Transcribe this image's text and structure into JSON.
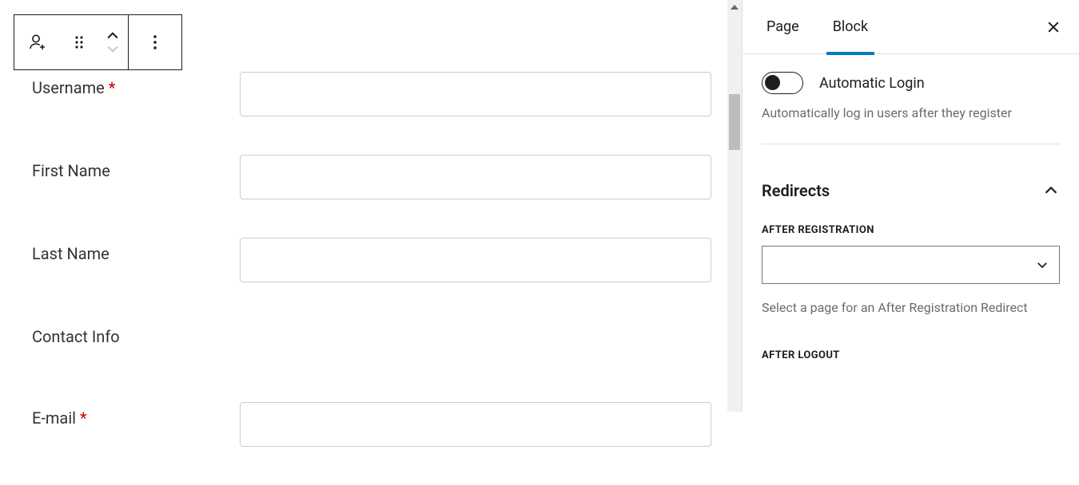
{
  "form": {
    "fields": [
      {
        "label": "Username",
        "required": true,
        "hasInput": true
      },
      {
        "label": "First Name",
        "required": false,
        "hasInput": true
      },
      {
        "label": "Last Name",
        "required": false,
        "hasInput": true
      },
      {
        "label": "Contact Info",
        "required": false,
        "hasInput": false
      },
      {
        "label": "E-mail",
        "required": true,
        "hasInput": true
      }
    ]
  },
  "sidebar": {
    "tabs": {
      "page": "Page",
      "block": "Block"
    },
    "autoLogin": {
      "label": "Automatic Login",
      "help": "Automatically log in users after they register"
    },
    "redirects": {
      "title": "Redirects",
      "afterRegistration": {
        "label": "AFTER REGISTRATION",
        "help": "Select a page for an After Registration Redirect"
      },
      "afterLogout": {
        "label": "AFTER LOGOUT"
      }
    }
  }
}
